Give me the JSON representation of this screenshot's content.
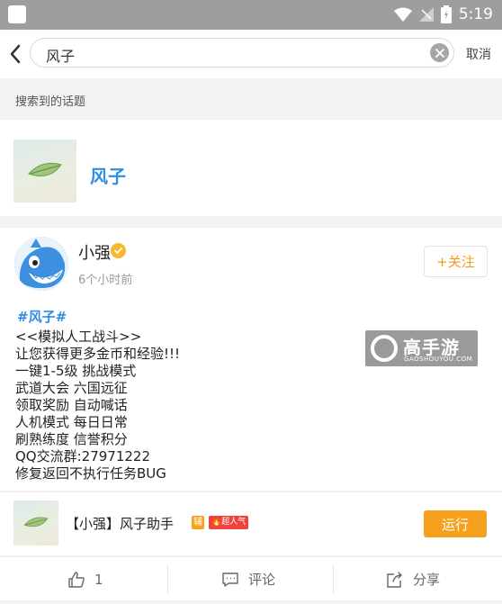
{
  "status_bar": {
    "time": "5:19",
    "battery": "5"
  },
  "search": {
    "query": "风子",
    "cancel_label": "取消"
  },
  "section": {
    "title": "搜索到的话题"
  },
  "topic": {
    "name": "风子"
  },
  "post": {
    "user_name": "小强",
    "time": "6个小时前",
    "follow_label": "+关注",
    "hashtag": "#风子#",
    "lines": [
      "<<模拟人工战斗>>",
      "让您获得更多金币和经验!!!",
      "一键1-5级 挑战模式",
      "武道大会  六国远征",
      "领取奖励  自动喊话",
      "人机模式  每日日常",
      "刷熟练度  信誉积分",
      "QQ交流群:27971222",
      "修复返回不执行任务BUG"
    ],
    "watermark": {
      "title": "高手游",
      "sub": "GAOSHOUYOU.COM"
    }
  },
  "app": {
    "name": "【小强】风子助手",
    "badge_type": "辅",
    "badge_hot": "超人气",
    "run_label": "运行"
  },
  "actions": {
    "like_count": "1",
    "comment_label": "评论",
    "share_label": "分享"
  },
  "colors": {
    "accent_orange": "#f6a11d",
    "link_blue": "#2f8de4"
  }
}
